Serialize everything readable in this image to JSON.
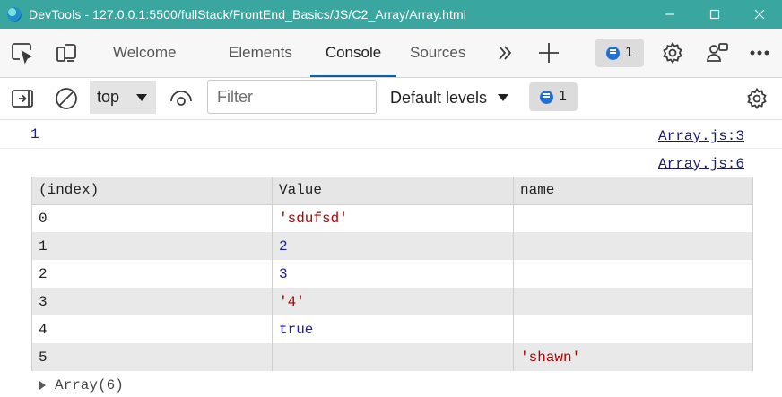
{
  "window": {
    "title": "DevTools - 127.0.0.1:5500/fullStack/FrontEnd_Basics/JS/C2_Array/Array.html",
    "title_bar_color": "#3aa6a0"
  },
  "tabs": [
    {
      "label": "Welcome",
      "active": false
    },
    {
      "label": "Elements",
      "active": false
    },
    {
      "label": "Console",
      "active": true
    },
    {
      "label": "Sources",
      "active": false
    }
  ],
  "tabbar": {
    "more_tabs_icon": "double-chevron-right-icon",
    "add_tab_icon": "plus-icon",
    "issues_count": "1",
    "settings_icon": "gear-icon",
    "customize_icon": "people-icon",
    "more_icon": "ellipsis-icon"
  },
  "console_toolbar": {
    "context": "top",
    "filter_placeholder": "Filter",
    "levels": "Default levels",
    "issues_count": "1"
  },
  "console": {
    "log1": {
      "value": "1",
      "source": "Array.js:3"
    },
    "log2": {
      "source": "Array.js:6"
    },
    "table": {
      "headers": [
        "(index)",
        "Value",
        "name"
      ],
      "rows": [
        {
          "index": "0",
          "value": "'sdufsd'",
          "name": ""
        },
        {
          "index": "1",
          "value": "2",
          "name": ""
        },
        {
          "index": "2",
          "value": "3",
          "name": ""
        },
        {
          "index": "3",
          "value": "'4'",
          "name": ""
        },
        {
          "index": "4",
          "value": "true",
          "name": ""
        },
        {
          "index": "5",
          "value": "",
          "name": "'shawn'"
        }
      ]
    },
    "summary": "Array(6)"
  },
  "colors": {
    "accent": "#0a5fb0",
    "string": "#b00000",
    "number": "#1a1aa6"
  }
}
